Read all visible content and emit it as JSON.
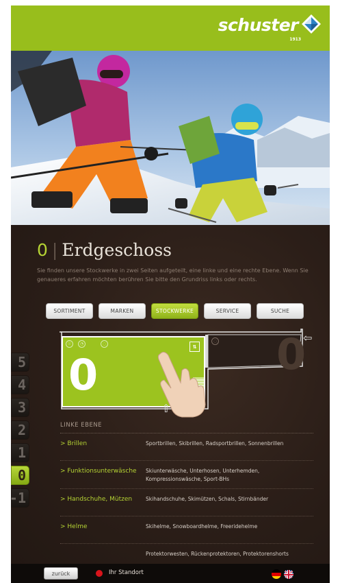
{
  "brand": {
    "name": "schuster",
    "year": "1913"
  },
  "floor": {
    "number": "0",
    "name": "Erdgeschoss",
    "description": "Sie finden unsere Stockwerke in zwei Seiten aufgeteilt, eine linke und eine rechte Ebene. Wenn Sie genaueres erfahren möchten berühren Sie bitte den Grundriss links oder rechts."
  },
  "tabs": [
    {
      "label": "SORTIMENT",
      "active": false
    },
    {
      "label": "MARKEN",
      "active": false
    },
    {
      "label": "STOCKWERKE",
      "active": true
    },
    {
      "label": "SERVICE",
      "active": false
    },
    {
      "label": "SUCHE",
      "active": false
    }
  ],
  "plan": {
    "left_number": "0",
    "right_number": "0"
  },
  "floors": [
    {
      "label": "5",
      "active": false
    },
    {
      "label": "4",
      "active": false
    },
    {
      "label": "3",
      "active": false
    },
    {
      "label": "2",
      "active": false
    },
    {
      "label": "1",
      "active": false
    },
    {
      "label": "0",
      "active": true
    },
    {
      "label": "-1",
      "active": false
    }
  ],
  "directory": {
    "heading": "LINKE EBENE",
    "rows": [
      {
        "category": "> Brillen",
        "items": "Sportbrillen, Skibrillen, Radsportbrillen, Sonnenbrillen"
      },
      {
        "category": "> Funktionsunterwäsche",
        "items": "Skiunterwäsche, Unterhosen, Unterhemden, Kompressionswäsche, Sport-BHs"
      },
      {
        "category": "> Handschuhe, Mützen",
        "items": "Skihandschuhe, Skimützen, Schals, Stirnbänder"
      },
      {
        "category": "> Helme",
        "items": "Skihelme, Snowboardhelme, Freeridehelme"
      },
      {
        "category": "",
        "items": "Protektorwesten, Rückenprotektoren, Protektorenshorts"
      }
    ]
  },
  "footer": {
    "back_label": "zurück",
    "location_label": "Ihr Standort"
  },
  "colors": {
    "accent": "#98be1c",
    "background": "#2c1f19",
    "location_dot": "#d8141b"
  }
}
